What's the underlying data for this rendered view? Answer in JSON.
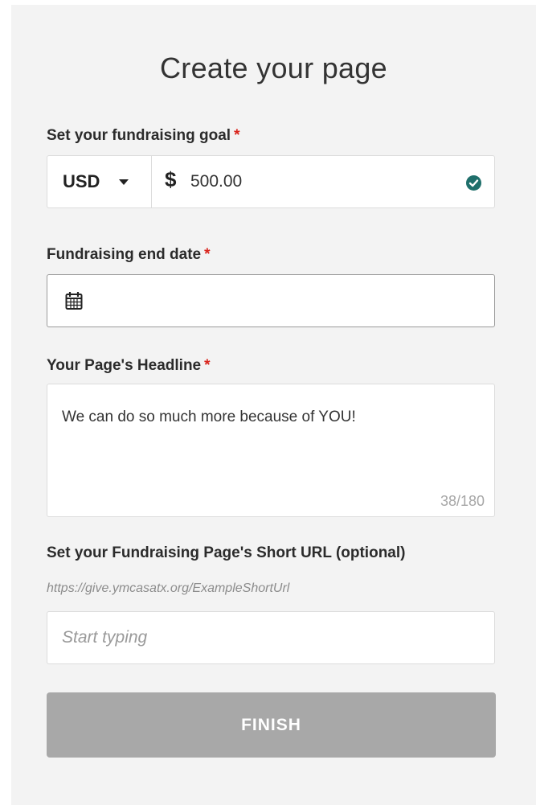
{
  "page": {
    "title": "Create your page"
  },
  "goal": {
    "label": "Set your fundraising goal",
    "required_mark": "*",
    "currency": "USD",
    "currency_symbol": "$",
    "amount": "500.00"
  },
  "end_date": {
    "label": "Fundraising end date",
    "required_mark": "*",
    "value": ""
  },
  "headline": {
    "label": "Your Page's Headline",
    "required_mark": "*",
    "value": "We can do so much more because of YOU!",
    "counter": "38/180"
  },
  "short_url": {
    "label": "Set your Fundraising Page's Short URL (optional)",
    "example": "https://give.ymcasatx.org/ExampleShortUrl",
    "placeholder": "Start typing"
  },
  "actions": {
    "finish_label": "FINISH"
  },
  "colors": {
    "required": "#d9241c",
    "check": "#1f6f6b",
    "finish_disabled": "#a8a8a8"
  },
  "icons": {
    "currency_caret": "chevron-down-icon",
    "valid": "check-circle-icon",
    "date": "calendar-icon"
  }
}
